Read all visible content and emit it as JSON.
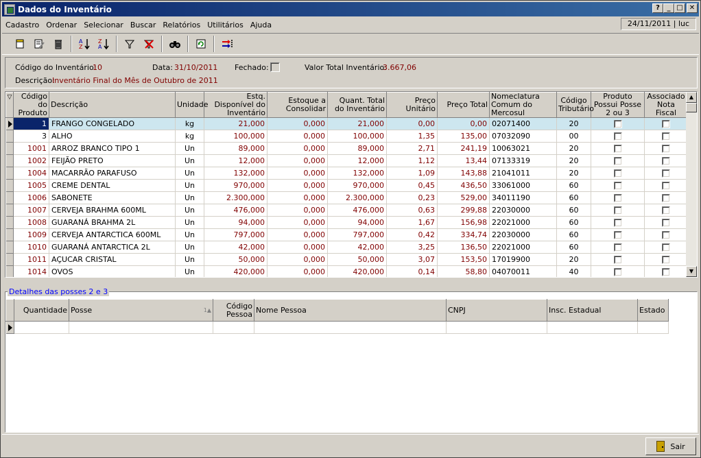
{
  "window": {
    "title": "Dados do Inventário"
  },
  "menu": [
    "Cadastro",
    "Ordenar",
    "Selecionar",
    "Buscar",
    "Relatórios",
    "Utilitários",
    "Ajuda"
  ],
  "status": "24/11/2011 | luc",
  "toolbar": [
    {
      "name": "new-record-icon",
      "glyph": "▯"
    },
    {
      "name": "edit-record-icon",
      "glyph": "✎"
    },
    {
      "name": "delete-icon",
      "glyph": "🗑"
    },
    {
      "name": "sort-asc-icon",
      "glyph": "A↓"
    },
    {
      "name": "sort-desc-icon",
      "glyph": "Z↓"
    },
    {
      "name": "filter-icon",
      "glyph": "▽"
    },
    {
      "name": "clear-filter-icon",
      "glyph": "✕"
    },
    {
      "name": "search-binoculars-icon",
      "glyph": "⌕"
    },
    {
      "name": "refresh-icon",
      "glyph": "⟳"
    },
    {
      "name": "import-icon",
      "glyph": "⇥"
    }
  ],
  "info": {
    "codigo_label": "Código do Inventário:",
    "codigo_value": "10",
    "data_label": "Data:",
    "data_value": "31/10/2011",
    "fechado_label": "Fechado:",
    "valor_label": "Valor Total Inventário:",
    "valor_value": "3.667,06",
    "descricao_label": "Descrição:",
    "descricao_value": "Inventário Final do Mês de Outubro de 2011"
  },
  "grid": {
    "headers": [
      "Código do Produto",
      "Descrição",
      "Unidade",
      "Estq. Disponível do Inventário",
      "Estoque a Consolidar",
      "Quant. Total do Inventário",
      "Preço Unitário",
      "Preço Total",
      "Nomeclatura Comum do Mercosul",
      "Código Tributário",
      "Produto Possui Posse 2 ou 3",
      "Associado Nota Fiscal"
    ],
    "rows": [
      {
        "codigo": "1",
        "descricao": "FRANGO CONGELADO",
        "unidade": "kg",
        "estq": "21,000",
        "consolidar": "0,000",
        "quant": "21,000",
        "unit": "0,00",
        "total": "0,00",
        "ncm": "02071400",
        "trib": "20"
      },
      {
        "codigo": "3",
        "descricao": "ALHO",
        "unidade": "kg",
        "estq": "100,000",
        "consolidar": "0,000",
        "quant": "100,000",
        "unit": "1,35",
        "total": "135,00",
        "ncm": "07032090",
        "trib": "00"
      },
      {
        "codigo": "1001",
        "descricao": "ARROZ BRANCO TIPO 1",
        "unidade": "Un",
        "estq": "89,000",
        "consolidar": "0,000",
        "quant": "89,000",
        "unit": "2,71",
        "total": "241,19",
        "ncm": "10063021",
        "trib": "20"
      },
      {
        "codigo": "1002",
        "descricao": "FEIJÃO PRETO",
        "unidade": "Un",
        "estq": "12,000",
        "consolidar": "0,000",
        "quant": "12,000",
        "unit": "1,12",
        "total": "13,44",
        "ncm": "07133319",
        "trib": "20"
      },
      {
        "codigo": "1004",
        "descricao": "MACARRÃO PARAFUSO",
        "unidade": "Un",
        "estq": "132,000",
        "consolidar": "0,000",
        "quant": "132,000",
        "unit": "1,09",
        "total": "143,88",
        "ncm": "21041011",
        "trib": "20"
      },
      {
        "codigo": "1005",
        "descricao": "CREME DENTAL",
        "unidade": "Un",
        "estq": "970,000",
        "consolidar": "0,000",
        "quant": "970,000",
        "unit": "0,45",
        "total": "436,50",
        "ncm": "33061000",
        "trib": "60"
      },
      {
        "codigo": "1006",
        "descricao": "SABONETE",
        "unidade": "Un",
        "estq": "2.300,000",
        "consolidar": "0,000",
        "quant": "2.300,000",
        "unit": "0,23",
        "total": "529,00",
        "ncm": "34011190",
        "trib": "60"
      },
      {
        "codigo": "1007",
        "descricao": "CERVEJA BRAHMA 600ML",
        "unidade": "Un",
        "estq": "476,000",
        "consolidar": "0,000",
        "quant": "476,000",
        "unit": "0,63",
        "total": "299,88",
        "ncm": "22030000",
        "trib": "60"
      },
      {
        "codigo": "1008",
        "descricao": "GUARANÁ BRAHMA 2L",
        "unidade": "Un",
        "estq": "94,000",
        "consolidar": "0,000",
        "quant": "94,000",
        "unit": "1,67",
        "total": "156,98",
        "ncm": "22021000",
        "trib": "60"
      },
      {
        "codigo": "1009",
        "descricao": "CERVEJA ANTARCTICA 600ML",
        "unidade": "Un",
        "estq": "797,000",
        "consolidar": "0,000",
        "quant": "797,000",
        "unit": "0,42",
        "total": "334,74",
        "ncm": "22030000",
        "trib": "60"
      },
      {
        "codigo": "1010",
        "descricao": "GUARANÁ ANTARCTICA 2L",
        "unidade": "Un",
        "estq": "42,000",
        "consolidar": "0,000",
        "quant": "42,000",
        "unit": "3,25",
        "total": "136,50",
        "ncm": "22021000",
        "trib": "60"
      },
      {
        "codigo": "1011",
        "descricao": "AÇUCAR CRISTAL",
        "unidade": "Un",
        "estq": "50,000",
        "consolidar": "0,000",
        "quant": "50,000",
        "unit": "3,07",
        "total": "153,50",
        "ncm": "17019900",
        "trib": "20"
      },
      {
        "codigo": "1014",
        "descricao": "OVOS",
        "unidade": "Un",
        "estq": "420,000",
        "consolidar": "0,000",
        "quant": "420,000",
        "unit": "0,14",
        "total": "58,80",
        "ncm": "04070011",
        "trib": "40"
      }
    ]
  },
  "sub": {
    "legend": "Detalhes das posses 2 e 3",
    "headers": [
      "Quantidade",
      "Posse",
      "Código Pessoa",
      "Nome Pessoa",
      "CNPJ",
      "Insc. Estadual",
      "Estado"
    ]
  },
  "footer": {
    "sair_label": "Sair"
  }
}
